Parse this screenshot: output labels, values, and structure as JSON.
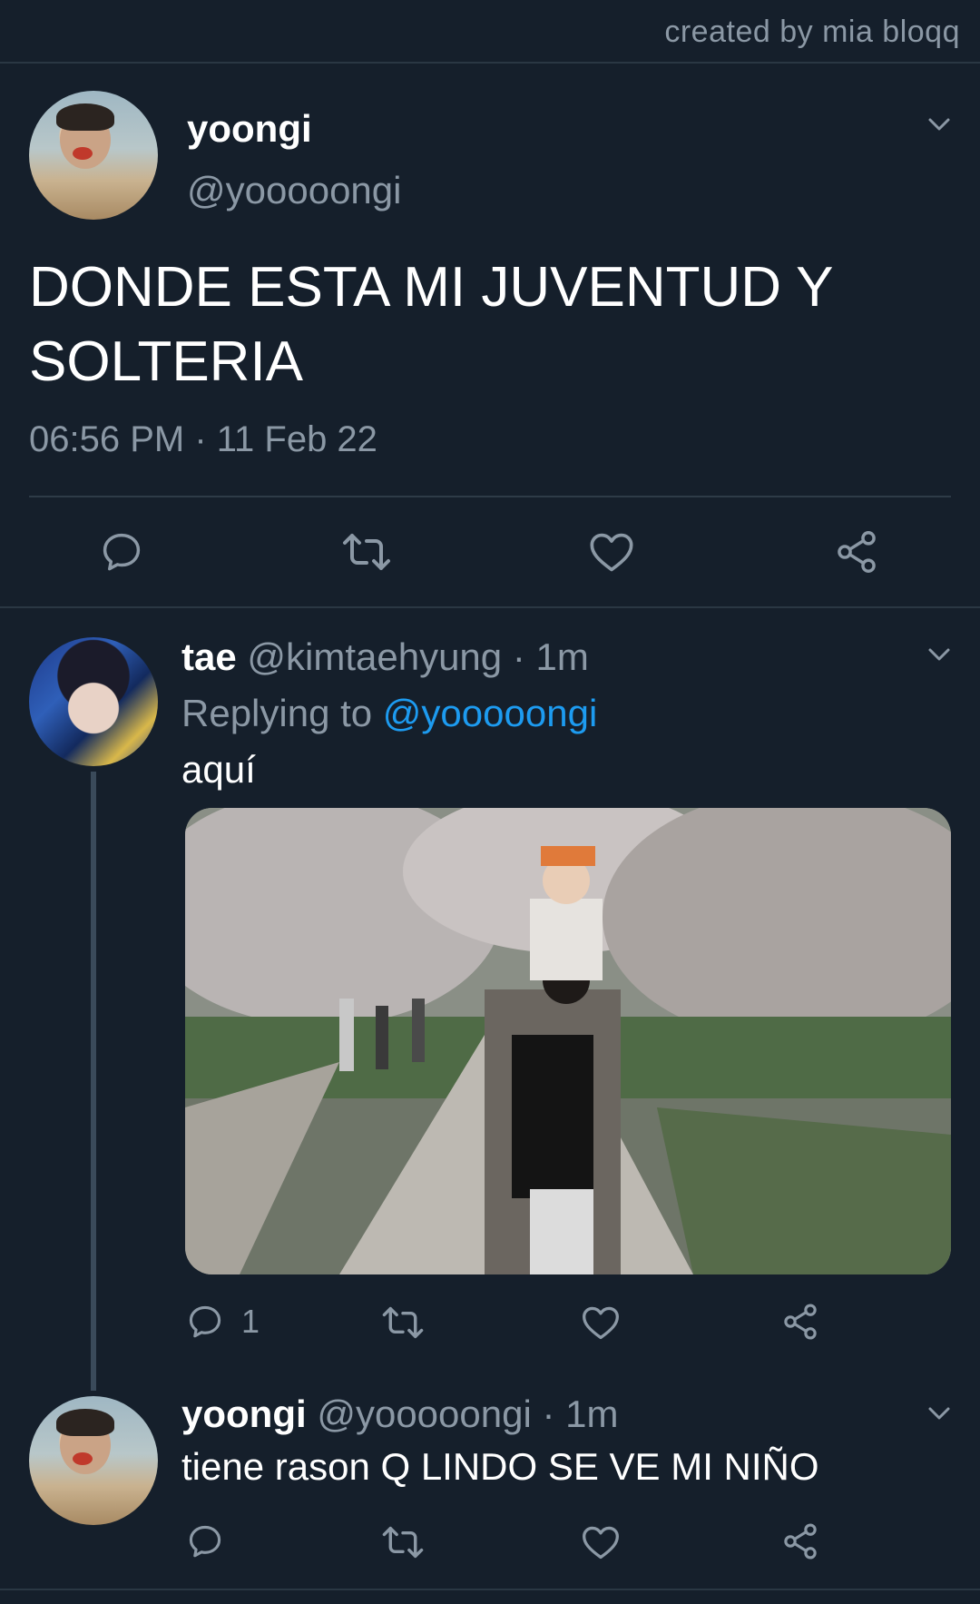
{
  "credit": "created by mia bloqq",
  "main_tweet": {
    "name": "yoongi",
    "handle": "@yooooongi",
    "text": "DONDE ESTA MI JUVENTUD Y SOLTERIA",
    "timestamp": "06:56 PM · 11 Feb 22",
    "avatar_icon": "avatar-photo-icon"
  },
  "reply_1": {
    "name": "tae",
    "handle": "@kimtaehyung",
    "time": "· 1m",
    "replying_label": "Replying to ",
    "replying_handle": "@yooooongi",
    "text": "aquí",
    "reply_count": "1",
    "image_alt": "photo of person holding child on shoulders under cherry blossom trees"
  },
  "reply_2": {
    "name": "yoongi",
    "handle": "@yooooongi",
    "time": "· 1m",
    "text": "tiene rason  Q LINDO SE VE MI NIÑO"
  },
  "colors": {
    "background": "#151f2b",
    "secondary_text": "#8b98a5",
    "link": "#1d9bf0",
    "divider": "#2a3743"
  }
}
